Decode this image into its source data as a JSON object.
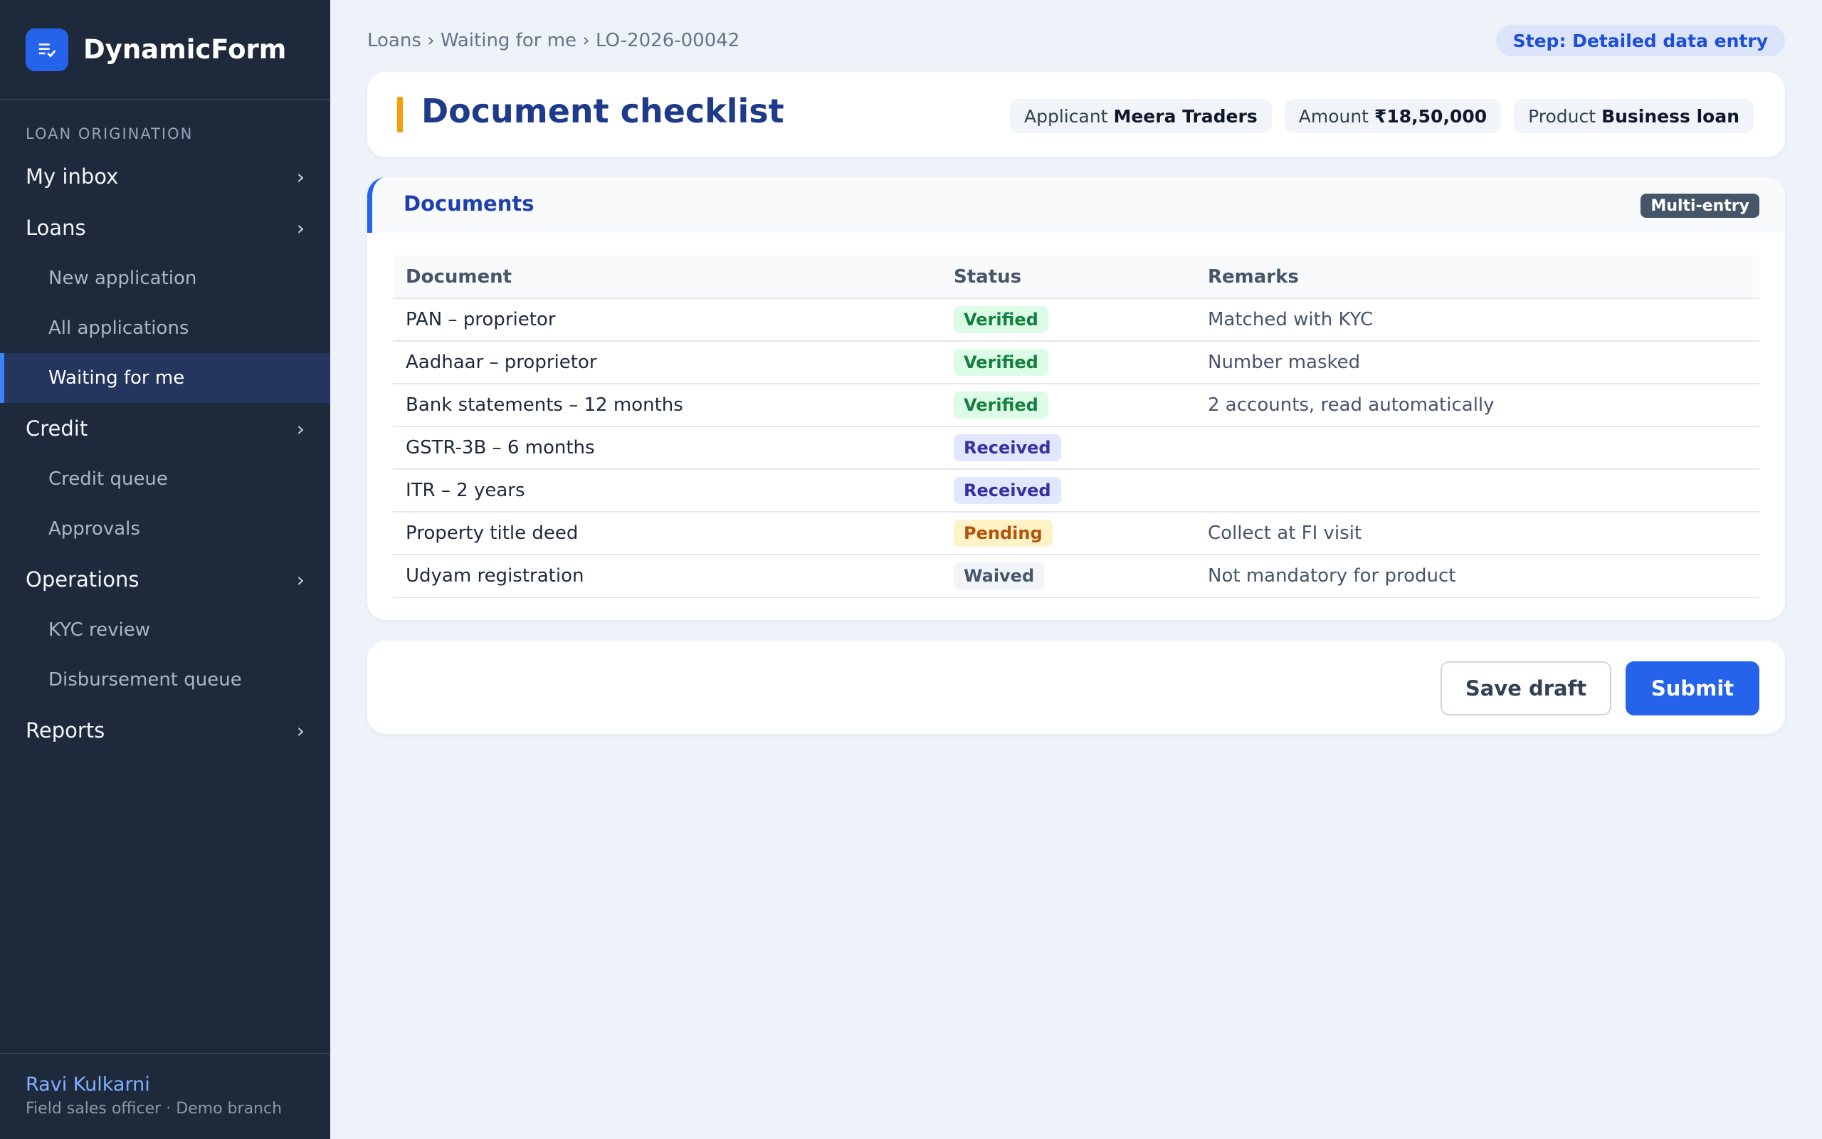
{
  "app": {
    "name": "DynamicForm"
  },
  "sidebar": {
    "section_label": "LOAN ORIGINATION",
    "items": [
      {
        "label": "My inbox",
        "type": "group"
      },
      {
        "label": "Loans",
        "type": "group"
      },
      {
        "label": "New application",
        "type": "sub"
      },
      {
        "label": "All applications",
        "type": "sub"
      },
      {
        "label": "Waiting for me",
        "type": "sub",
        "active": true
      },
      {
        "label": "Credit",
        "type": "group"
      },
      {
        "label": "Credit queue",
        "type": "sub"
      },
      {
        "label": "Approvals",
        "type": "sub"
      },
      {
        "label": "Operations",
        "type": "group"
      },
      {
        "label": "KYC review",
        "type": "sub"
      },
      {
        "label": "Disbursement queue",
        "type": "sub"
      },
      {
        "label": "Reports",
        "type": "group"
      }
    ],
    "user": {
      "name": "Ravi Kulkarni",
      "role": "Field sales officer · Demo branch"
    }
  },
  "header": {
    "breadcrumb": "Loans › Waiting for me › LO-2026-00042",
    "step": "Step: Detailed data entry",
    "title": "Document checklist",
    "chips": [
      {
        "label": "Applicant",
        "value": "Meera Traders"
      },
      {
        "label": "Amount",
        "value": "₹18,50,000"
      },
      {
        "label": "Product",
        "value": "Business loan"
      }
    ]
  },
  "documents": {
    "section_title": "Documents",
    "badge": "Multi-entry",
    "columns": [
      "Document",
      "Status",
      "Remarks"
    ],
    "rows": [
      {
        "document": "PAN – proprietor",
        "status": "Verified",
        "remarks": "Matched with KYC"
      },
      {
        "document": "Aadhaar – proprietor",
        "status": "Verified",
        "remarks": "Number masked"
      },
      {
        "document": "Bank statements – 12 months",
        "status": "Verified",
        "remarks": "2 accounts, read automatically"
      },
      {
        "document": "GSTR-3B – 6 months",
        "status": "Received",
        "remarks": ""
      },
      {
        "document": "ITR – 2 years",
        "status": "Received",
        "remarks": ""
      },
      {
        "document": "Property title deed",
        "status": "Pending",
        "remarks": "Collect at FI visit"
      },
      {
        "document": "Udyam registration",
        "status": "Waived",
        "remarks": "Not mandatory for product"
      }
    ]
  },
  "actions": {
    "save_draft": "Save draft",
    "submit": "Submit"
  },
  "colors": {
    "sidebar_bg": "#1e293b",
    "accent": "#2563eb",
    "title": "#1e3a8a",
    "verified": "#15803d",
    "received": "#3730a3",
    "pending": "#b45309",
    "waived": "#475569"
  }
}
